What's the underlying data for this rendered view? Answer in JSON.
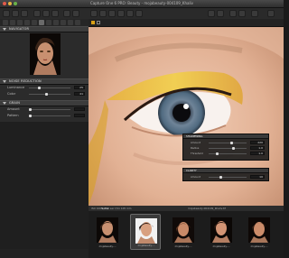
{
  "window": {
    "title": "Capture One 6 PRO: Beauty - mojabeauty-004109_Khaliv"
  },
  "panels": {
    "navigator": {
      "title": "NAVIGATOR"
    },
    "noise_reduction": {
      "title": "NOISE REDUCTION",
      "rows": [
        {
          "label": "Luminance",
          "value": "25"
        },
        {
          "label": "Color",
          "value": "41"
        }
      ]
    },
    "grain": {
      "title": "GRAIN",
      "rows": [
        {
          "label": "Amount",
          "value": ""
        },
        {
          "label": "Pattern",
          "value": ""
        }
      ]
    }
  },
  "floating": {
    "sharpening": {
      "title": "SHARPENING",
      "rows": [
        {
          "label": "Amount",
          "value": "220"
        },
        {
          "label": "Radius",
          "value": "1.0"
        },
        {
          "label": "Threshold",
          "value": "1.0"
        }
      ]
    },
    "clarity": {
      "title": "CLARITY",
      "rows": [
        {
          "label": "Amount",
          "value": "10"
        }
      ]
    }
  },
  "viewer": {
    "status": "ISO 100   1/250 sec   f/11   105 mm",
    "filename": "mojabeauty-004109_Khaliv.tif"
  },
  "filmstrip": {
    "sort_label": "Name",
    "thumbs": [
      {
        "caption": "mojabeauty-..."
      },
      {
        "caption": "mojabeauty-..."
      },
      {
        "caption": "mojabeauty-..."
      },
      {
        "caption": "mojabeauty-..."
      },
      {
        "caption": "mojabeauty-..."
      }
    ]
  },
  "colors": {
    "accent": "#d8a018",
    "panel": "#2b2b2b",
    "header": "#3c3c3c"
  }
}
